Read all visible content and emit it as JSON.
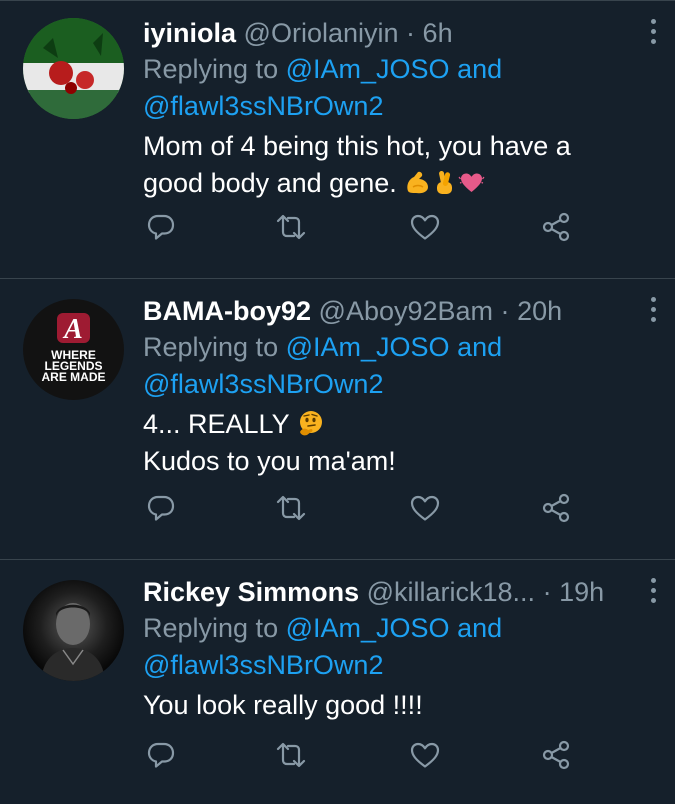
{
  "colors": {
    "background": "#15202b",
    "divider": "#38444d",
    "secondary_text": "#8899a6",
    "link": "#1da1f2",
    "primary_text": "#ffffff"
  },
  "icons": [
    "reply-icon",
    "retweet-icon",
    "like-icon",
    "share-icon",
    "more-options-icon"
  ],
  "tweets": [
    {
      "name": "iyiniola",
      "handle": "@Oriolaniyin",
      "separator": "·",
      "time": "6h",
      "replying_prefix": "Replying to",
      "reply_user_1": "@IAm_JOSO",
      "reply_conjunction": "and",
      "reply_user_2": "@flawl3ssNBrOwn2",
      "text_line_1": "Mom of 4 being this hot, you have a",
      "text_line_2": "good body and gene.",
      "emojis": [
        "flexed-biceps-emoji",
        "crossed-fingers-emoji",
        "beating-heart-emoji"
      ]
    },
    {
      "name": "BAMA-boy92",
      "handle": "@Aboy92Bam",
      "separator": "·",
      "time": "20h",
      "replying_prefix": "Replying to",
      "reply_user_1": "@IAm_JOSO",
      "reply_conjunction": "and",
      "reply_user_2": "@flawl3ssNBrOwn2",
      "text_line_1": "4... REALLY",
      "text_line_2": "Kudos to you ma'am!",
      "emojis": [
        "thinking-face-emoji"
      ],
      "avatar_text": {
        "letter": "A",
        "line_1": "WHERE",
        "line_2": "LEGENDS",
        "line_3": "ARE MADE"
      }
    },
    {
      "name": "Rickey Simmons",
      "handle": "@killarick18...",
      "separator": "·",
      "time": "19h",
      "replying_prefix": "Replying to",
      "reply_user_1": "@IAm_JOSO",
      "reply_conjunction": "and",
      "reply_user_2": "@flawl3ssNBrOwn2",
      "text_line_1": "You look really good !!!!"
    }
  ]
}
